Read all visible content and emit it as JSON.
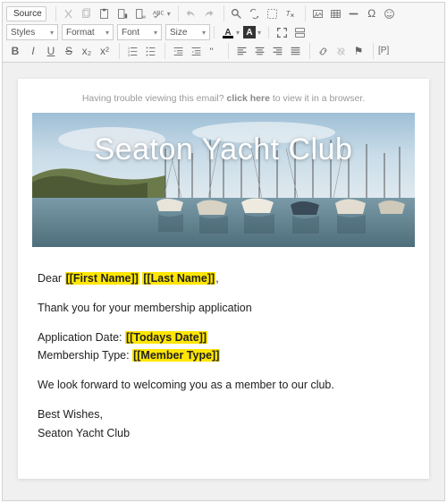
{
  "toolbar": {
    "source_label": "Source",
    "styles_label": "Styles",
    "format_label": "Format",
    "font_label": "Font",
    "size_label": "Size",
    "txtcolor_A": "A",
    "bgcolor_A": "A",
    "bold": "B",
    "italic": "I",
    "underline": "U",
    "strike": "S",
    "sub": "x₂",
    "sup": "x²",
    "omega": "Ω",
    "pilcrow": "¶",
    "flag": "⚑",
    "placeholder": "[P]"
  },
  "email": {
    "preheader_prefix": "Having trouble viewing this email? ",
    "preheader_link": "click here",
    "preheader_suffix": " to view it in a browser.",
    "hero_title": "Seaton Yacht Club",
    "greeting_prefix": "Dear ",
    "token_first": "[[First Name]]",
    "token_last": "[[Last Name]]",
    "greeting_suffix": ",",
    "line_thanks": "Thank you for your membership application",
    "app_date_label": "Application Date: ",
    "token_date": "[[Todays Date]]",
    "mem_type_label": "Membership Type: ",
    "token_mtype": "[[Member Type]]",
    "line_welcome": "We look forward to welcoming you as a member to our club.",
    "sig1": "Best Wishes,",
    "sig2": "Seaton Yacht Club"
  }
}
